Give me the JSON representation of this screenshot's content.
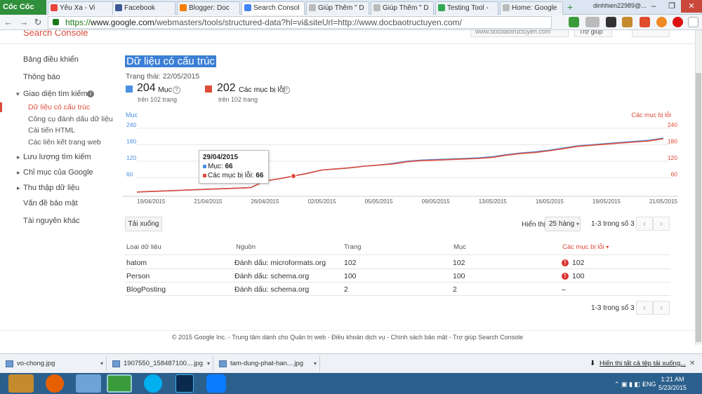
{
  "browser": {
    "logo": "Cốc Cốc",
    "tabs": [
      {
        "label": "Yêu Xa - Vi",
        "color": "#e8453c"
      },
      {
        "label": "Facebook",
        "color": "#3b5998"
      },
      {
        "label": "Blogger: Doc",
        "color": "#f57d00"
      },
      {
        "label": "Search Consol",
        "color": "#4285f4"
      },
      {
        "label": "Giúp Thêm \" D",
        "color": "#bbbbbb"
      },
      {
        "label": "Giúp Thêm \" D",
        "color": "#bbbbbb"
      },
      {
        "label": "Testing Tool -",
        "color": "#34a853"
      },
      {
        "label": "Home: Google",
        "color": "#bbbbbb"
      }
    ],
    "new_tab": "+",
    "user": "dinhhien22989@...",
    "win_min": "–",
    "win_max": "❐",
    "win_close": "✕",
    "back_glyph": "←",
    "forward_glyph": "→",
    "reload_glyph": "↻",
    "url_scheme": "https://",
    "url_host": "www.google.com",
    "url_path": "/webmasters/tools/structured-data?hl=vi&siteUrl=http://www.docbaotructuyen.com/"
  },
  "header": {
    "product": "Search Console",
    "site": "www.docbaotructuyen.com",
    "help": "Trợ giúp"
  },
  "sidebar": {
    "items": [
      {
        "label": "Bảng điều khiển"
      },
      {
        "label": "Thông báo"
      },
      {
        "label": "Giao diện tìm kiếm"
      },
      {
        "label": "Dữ liệu có cấu trúc"
      },
      {
        "label": "Công cụ đánh dấu dữ liệu"
      },
      {
        "label": "Cải tiến HTML"
      },
      {
        "label": "Các liên kết trang web"
      },
      {
        "label": "Lưu lượng tìm kiếm"
      },
      {
        "label": "Chỉ mục của Google"
      },
      {
        "label": "Thu thập dữ liệu"
      },
      {
        "label": "Vấn đề bảo mật"
      },
      {
        "label": "Tài nguyên khác"
      }
    ],
    "toggle_open": "▾",
    "toggle_closed": "▸",
    "info_glyph": "i"
  },
  "page": {
    "title": "Dữ liệu có cấu trúc",
    "status": "Trạng thái: 22/05/2015",
    "metric1": {
      "value": "204",
      "label": "Mục",
      "sub": "trên 102 trang",
      "color": "#4a90e2"
    },
    "metric2": {
      "value": "202",
      "label": "Các mục bị lỗi",
      "sub": "trên 102 trang",
      "color": "#dd4b39"
    },
    "help_glyph": "?"
  },
  "chart_data": {
    "type": "line",
    "left_axis_title": "Mục",
    "right_axis_title": "Các mục bị lỗi",
    "yticks": [
      60,
      120,
      180,
      240
    ],
    "ylim": [
      0,
      260
    ],
    "xticks": [
      "19/04/2015",
      "21/04/2015",
      "26/04/2015",
      "02/05/2015",
      "05/05/2015",
      "09/05/2015",
      "13/05/2015",
      "16/05/2015",
      "19/05/2015",
      "21/05/2015"
    ],
    "xtick_positions": [
      1,
      5,
      9,
      13,
      17,
      21,
      25,
      29,
      33,
      37
    ],
    "series": [
      {
        "name": "Mục",
        "color": "#4a90e2",
        "values": [
          8,
          10,
          12,
          14,
          16,
          18,
          20,
          22,
          24,
          48,
          56,
          66,
          76,
          88,
          92,
          96,
          102,
          106,
          112,
          120,
          124,
          126,
          128,
          130,
          132,
          136,
          144,
          150,
          154,
          160,
          168,
          176,
          180,
          184,
          188,
          192,
          196,
          204
        ]
      },
      {
        "name": "Các mục bị lỗi",
        "color": "#dd4b39",
        "values": [
          8,
          10,
          12,
          14,
          16,
          18,
          20,
          22,
          24,
          48,
          56,
          66,
          76,
          88,
          92,
          96,
          102,
          106,
          110,
          118,
          122,
          124,
          126,
          128,
          130,
          134,
          142,
          148,
          152,
          158,
          166,
          174,
          178,
          182,
          186,
          190,
          194,
          202
        ]
      }
    ],
    "tooltip": {
      "date": "29/04/2015",
      "items_label": "Mục:",
      "items_value": "66",
      "errors_label": "Các mục bị lỗi:",
      "errors_value": "66"
    }
  },
  "controls": {
    "download": "Tải xuống",
    "show_label": "Hiển thị",
    "rows_select": "25 hàng",
    "range": "1-3 trong số 3",
    "prev_glyph": "‹",
    "next_glyph": "›"
  },
  "table": {
    "headers": [
      "Loại dữ liệu",
      "Nguồn",
      "Trang",
      "Mục",
      "Các mục bị lỗi"
    ],
    "sort_glyph": "▾",
    "error_glyph": "!",
    "rows": [
      [
        "hatom",
        "Đánh dấu: microformats.org",
        "102",
        "102",
        "102"
      ],
      [
        "Person",
        "Đánh dấu: schema.org",
        "100",
        "100",
        "100"
      ],
      [
        "BlogPosting",
        "Đánh dấu: schema.org",
        "2",
        "2",
        "–"
      ]
    ]
  },
  "footer": "© 2015 Google Inc. - Trung tâm dành cho Quản trị web - Điều khoản dịch vụ - Chính sách bảo mật - Trợ giúp Search Console",
  "downloads": {
    "files": [
      "vo-chong.jpg",
      "1907550_158487100....jpg",
      "tam-dung-phat-han....jpg"
    ],
    "dropdown_glyph": "▾",
    "show_all": "Hiển thị tất cả tệp tải xuống...",
    "close": "✕"
  },
  "taskbar": {
    "lang": "ENG",
    "time": "1:21 AM",
    "date": "5/23/2015"
  }
}
